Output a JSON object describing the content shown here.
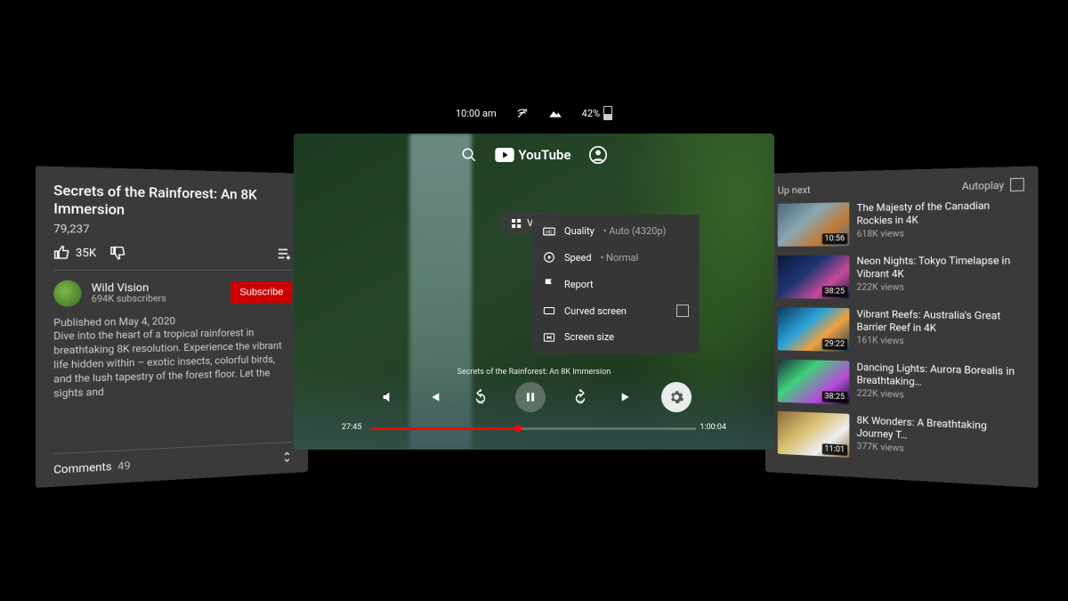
{
  "status": {
    "time": "10:00 am",
    "battery": "42%"
  },
  "header": {
    "brand": "YouTube",
    "videos_chip": "Videos"
  },
  "settings": {
    "quality_label": "Quality",
    "quality_value": "Auto (4320p)",
    "speed_label": "Speed",
    "speed_value": "Normal",
    "report_label": "Report",
    "curved_label": "Curved screen",
    "size_label": "Screen size"
  },
  "player": {
    "caption": "Secrets of the Rainforest: An 8K Immersion",
    "current_time": "27:45",
    "duration": "1:00:04"
  },
  "info": {
    "title": "Secrets of the Rainforest: An 8K Immersion",
    "views": "79,237",
    "likes": "35K",
    "channel_name": "Wild Vision",
    "channel_subs": "694K subscribers",
    "subscribe_label": "Subscribe",
    "description": "Published on May 4, 2020\nDive into the heart of a tropical rainforest in breathtaking 8K resolution. Experience the vibrant life hidden  within – exotic insects, colorful birds, and the lush tapestry of the forest floor.   Let the sights and",
    "comments_label": "Comments",
    "comments_count": "49"
  },
  "upnext": {
    "heading": "Up next",
    "autoplay_label": "Autoplay",
    "items": [
      {
        "title": "The Majesty of the Canadian Rockies in 4K",
        "views": "618K views",
        "duration": "10:56"
      },
      {
        "title": "Neon Nights: Tokyo Timelapse in Vibrant 4K",
        "views": "222K views",
        "duration": "38:25"
      },
      {
        "title": "Vibrant Reefs: Australia's Great Barrier Reef in 4K",
        "views": "161K views",
        "duration": "29:22"
      },
      {
        "title": "Dancing Lights: Aurora Borealis in Breathtaking…",
        "views": "222K views",
        "duration": "38:25"
      },
      {
        "title": "8K Wonders: A Breathtaking Journey T…",
        "views": "377K views",
        "duration": "11:01"
      }
    ]
  }
}
